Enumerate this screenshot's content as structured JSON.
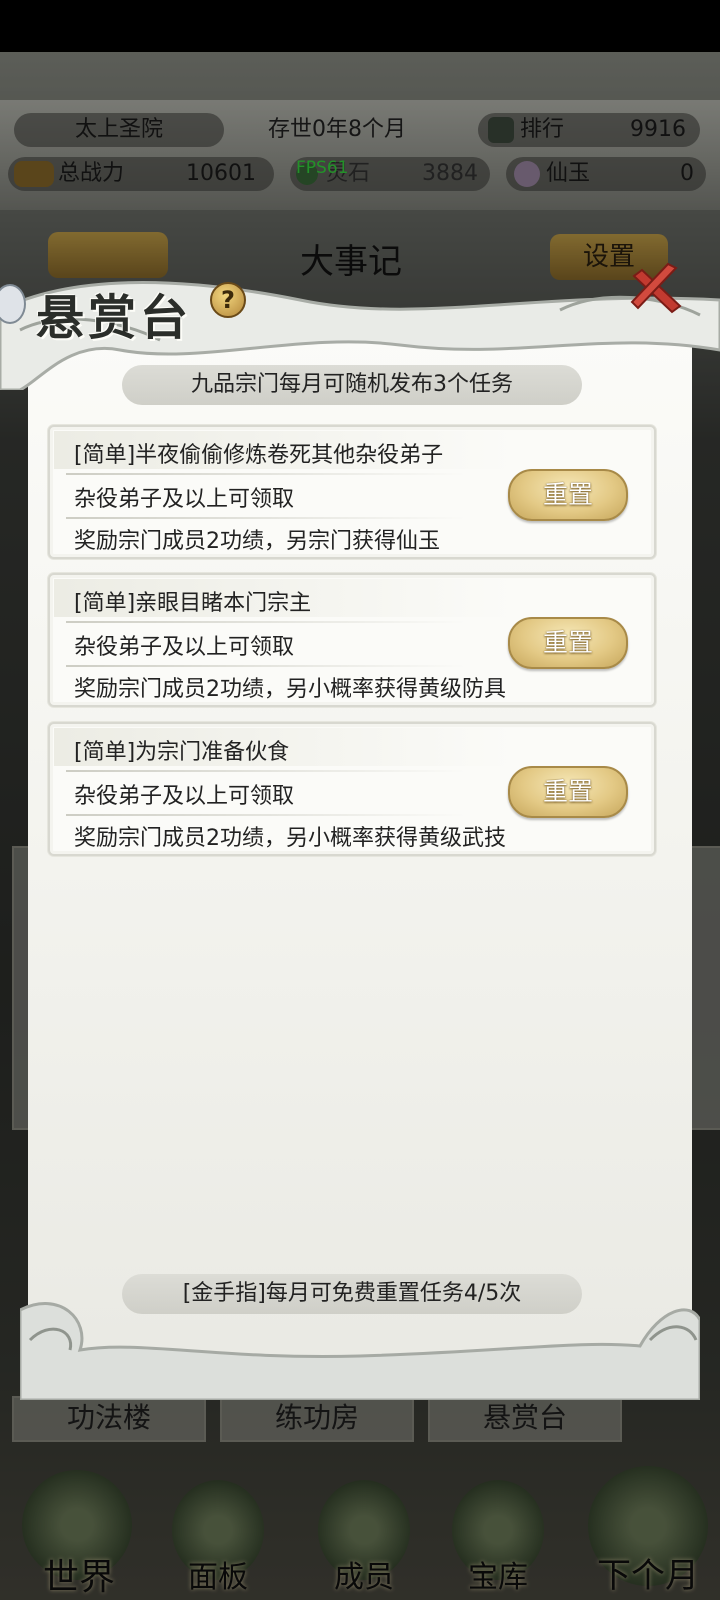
{
  "top": {
    "sect_name": "太上圣院",
    "existence": "存世0年8个月",
    "rank_label": "排行",
    "rank_value": "9916",
    "power_label": "总战力",
    "power_value": "10601",
    "fps": "FPS61",
    "spirit_stone_label": "灵石",
    "spirit_stone_value": "3884",
    "jade_label": "仙玉",
    "jade_value": "0"
  },
  "background": {
    "chronicle_title": "大事记",
    "settings_label": "设置",
    "nav": [
      "功法楼",
      "练功房",
      "悬赏台"
    ]
  },
  "bottom_nav": [
    "世界",
    "面板",
    "成员",
    "宝库",
    "下个月"
  ],
  "modal": {
    "title": "悬赏台",
    "help": "?",
    "banner": "九品宗门每月可随机发布3个任务",
    "footer": "[金手指]每月可免费重置任务4/5次",
    "tasks": [
      {
        "title": "[简单]半夜偷偷修炼卷死其他杂役弟子",
        "requirement": "杂役弟子及以上可领取",
        "reward": "奖励宗门成员2功绩，另宗门获得仙玉",
        "button": "重置"
      },
      {
        "title": "[简单]亲眼目睹本门宗主",
        "requirement": "杂役弟子及以上可领取",
        "reward": "奖励宗门成员2功绩，另小概率获得黄级防具",
        "button": "重置"
      },
      {
        "title": "[简单]为宗门准备伙食",
        "requirement": "杂役弟子及以上可领取",
        "reward": "奖励宗门成员2功绩，另小概率获得黄级武技",
        "button": "重置"
      }
    ]
  },
  "colors": {
    "reset_button": "#e3c985",
    "close_x": "#c23a30",
    "fps": "#36e040"
  }
}
